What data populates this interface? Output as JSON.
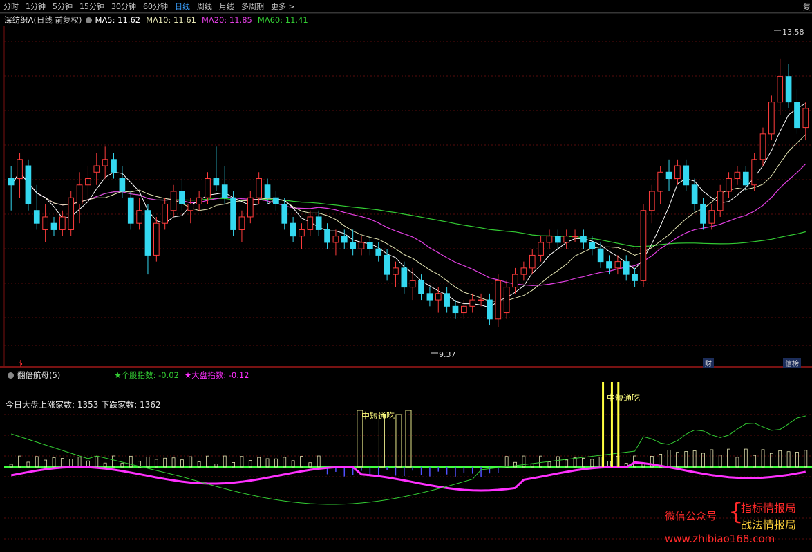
{
  "menu": {
    "tabs": [
      "分时",
      "1分钟",
      "5分钟",
      "15分钟",
      "30分钟",
      "60分钟",
      "日线",
      "周线",
      "月线",
      "多周期",
      "更多 >"
    ],
    "active_index": 6,
    "right_label": "复"
  },
  "info": {
    "name": "深纺织A",
    "period": "(日线 前复权)",
    "ma5": "MA5: 11.62",
    "ma10": "MA10: 11.61",
    "ma20": "MA20: 11.85",
    "ma60": "MA60: 11.41"
  },
  "indicator": {
    "name": "翻倍航母(5)",
    "stock_index": "★个股指数: -0.02",
    "market_index": "★大盘指数: -0.12",
    "updown": "今日大盘上涨家数: 1353 下跌家数: 1362",
    "signal_label_1": "中短通吃",
    "signal_label_2": "中短通吃"
  },
  "markers": {
    "high": "13.58",
    "low": "9.37",
    "badge_cai": "财",
    "badge_xin": "信榜",
    "dollar": "$"
  },
  "watermark": {
    "left": "微信公众号",
    "brace": "{",
    "right1": "指标情报局",
    "right2": "战法情报局",
    "url": "www.zhibiao168.com"
  },
  "colors": {
    "up": "#ff3c3c",
    "down": "#34d8f0",
    "ma5": "#ffffff",
    "ma10": "#e6e6b4",
    "ma20": "#e23fe2",
    "ma60": "#33cc33",
    "grid": "#5a0c0c",
    "signal": "#ffff40",
    "magenta_line": "#ff30ff",
    "green_line": "#33cc33"
  },
  "chart_data": {
    "type": "candlestick",
    "price_range": [
      9.0,
      14.0
    ],
    "high_label": 13.58,
    "low_label": 9.37,
    "candles": [
      [
        11.7,
        11.9,
        11.2,
        11.6
      ],
      [
        11.7,
        12.1,
        11.4,
        12.0
      ],
      [
        11.9,
        12.0,
        11.2,
        11.3
      ],
      [
        11.2,
        11.6,
        10.9,
        11.0
      ],
      [
        10.9,
        11.3,
        10.7,
        11.1
      ],
      [
        11.0,
        11.1,
        10.8,
        10.9
      ],
      [
        10.9,
        11.2,
        10.8,
        11.1
      ],
      [
        10.9,
        11.5,
        10.8,
        11.4
      ],
      [
        11.3,
        11.8,
        11.0,
        11.6
      ],
      [
        11.6,
        11.9,
        11.4,
        11.7
      ],
      [
        11.8,
        12.1,
        11.6,
        11.9
      ],
      [
        11.9,
        12.2,
        11.7,
        12.0
      ],
      [
        12.0,
        12.1,
        11.7,
        11.8
      ],
      [
        11.7,
        11.9,
        11.4,
        11.5
      ],
      [
        11.4,
        11.5,
        10.9,
        11.0
      ],
      [
        11.0,
        11.4,
        10.9,
        11.2
      ],
      [
        11.2,
        11.3,
        10.2,
        10.5
      ],
      [
        10.5,
        11.1,
        10.4,
        11.0
      ],
      [
        11.0,
        11.4,
        10.9,
        11.3
      ],
      [
        11.2,
        11.6,
        11.1,
        11.5
      ],
      [
        11.5,
        11.7,
        11.2,
        11.3
      ],
      [
        11.2,
        11.4,
        11.0,
        11.3
      ],
      [
        11.3,
        11.5,
        11.2,
        11.4
      ],
      [
        11.4,
        11.8,
        11.3,
        11.7
      ],
      [
        11.7,
        12.2,
        11.5,
        11.6
      ],
      [
        11.6,
        11.9,
        11.3,
        11.4
      ],
      [
        11.4,
        11.5,
        10.8,
        10.9
      ],
      [
        10.9,
        11.2,
        10.7,
        11.1
      ],
      [
        11.1,
        11.5,
        11.0,
        11.4
      ],
      [
        11.4,
        11.8,
        11.3,
        11.7
      ],
      [
        11.6,
        11.7,
        11.3,
        11.4
      ],
      [
        11.4,
        11.5,
        11.2,
        11.3
      ],
      [
        11.3,
        11.4,
        10.9,
        11.0
      ],
      [
        11.0,
        11.1,
        10.7,
        10.8
      ],
      [
        10.8,
        11.0,
        10.6,
        10.9
      ],
      [
        10.9,
        11.2,
        10.8,
        11.1
      ],
      [
        11.1,
        11.2,
        10.8,
        10.9
      ],
      [
        10.9,
        11.0,
        10.6,
        10.7
      ],
      [
        10.7,
        10.9,
        10.5,
        10.8
      ],
      [
        10.8,
        10.9,
        10.6,
        10.7
      ],
      [
        10.7,
        10.9,
        10.5,
        10.6
      ],
      [
        10.6,
        10.8,
        10.5,
        10.7
      ],
      [
        10.7,
        10.8,
        10.5,
        10.6
      ],
      [
        10.6,
        10.7,
        10.4,
        10.5
      ],
      [
        10.5,
        10.6,
        10.1,
        10.2
      ],
      [
        10.2,
        10.4,
        10.0,
        10.3
      ],
      [
        10.3,
        10.4,
        9.9,
        10.0
      ],
      [
        10.0,
        10.3,
        9.8,
        10.1
      ],
      [
        10.1,
        10.2,
        9.8,
        9.9
      ],
      [
        9.9,
        10.0,
        9.7,
        9.8
      ],
      [
        9.8,
        10.0,
        9.6,
        9.9
      ],
      [
        9.9,
        10.0,
        9.6,
        9.7
      ],
      [
        9.7,
        9.8,
        9.5,
        9.6
      ],
      [
        9.6,
        9.8,
        9.5,
        9.7
      ],
      [
        9.7,
        9.9,
        9.6,
        9.8
      ],
      [
        9.8,
        9.9,
        9.7,
        9.8
      ],
      [
        9.8,
        9.9,
        9.4,
        9.5
      ],
      [
        9.5,
        10.2,
        9.37,
        10.1
      ],
      [
        9.6,
        10.1,
        9.5,
        10.0
      ],
      [
        10.0,
        10.3,
        9.9,
        10.2
      ],
      [
        10.2,
        10.4,
        10.1,
        10.3
      ],
      [
        10.3,
        10.6,
        10.2,
        10.5
      ],
      [
        10.5,
        10.8,
        10.4,
        10.7
      ],
      [
        10.7,
        10.9,
        10.6,
        10.8
      ],
      [
        10.8,
        10.9,
        10.6,
        10.7
      ],
      [
        10.7,
        10.9,
        10.6,
        10.8
      ],
      [
        10.8,
        10.9,
        10.7,
        10.8
      ],
      [
        10.8,
        10.9,
        10.6,
        10.7
      ],
      [
        10.7,
        10.8,
        10.5,
        10.6
      ],
      [
        10.6,
        10.7,
        10.3,
        10.4
      ],
      [
        10.4,
        10.5,
        10.2,
        10.3
      ],
      [
        10.3,
        10.5,
        10.2,
        10.4
      ],
      [
        10.4,
        10.5,
        10.1,
        10.2
      ],
      [
        10.2,
        10.3,
        10.0,
        10.1
      ],
      [
        10.1,
        11.3,
        10.0,
        11.2
      ],
      [
        11.2,
        11.6,
        11.0,
        11.5
      ],
      [
        11.5,
        11.9,
        11.3,
        11.8
      ],
      [
        11.8,
        12.0,
        11.5,
        11.7
      ],
      [
        11.7,
        12.0,
        11.6,
        11.9
      ],
      [
        11.9,
        12.0,
        11.5,
        11.6
      ],
      [
        11.6,
        11.7,
        11.2,
        11.3
      ],
      [
        11.3,
        11.4,
        10.9,
        11.0
      ],
      [
        11.0,
        11.3,
        10.9,
        11.2
      ],
      [
        11.2,
        11.6,
        11.1,
        11.5
      ],
      [
        11.5,
        11.8,
        11.4,
        11.7
      ],
      [
        11.7,
        11.9,
        11.6,
        11.8
      ],
      [
        11.8,
        11.9,
        11.5,
        11.6
      ],
      [
        11.6,
        12.1,
        11.5,
        12.0
      ],
      [
        12.0,
        12.5,
        11.9,
        12.4
      ],
      [
        12.4,
        13.0,
        12.3,
        12.9
      ],
      [
        12.9,
        13.58,
        12.7,
        13.3
      ],
      [
        13.3,
        13.5,
        12.8,
        12.9
      ],
      [
        12.9,
        13.1,
        12.4,
        12.5
      ],
      [
        12.5,
        12.9,
        12.3,
        12.8
      ]
    ]
  }
}
